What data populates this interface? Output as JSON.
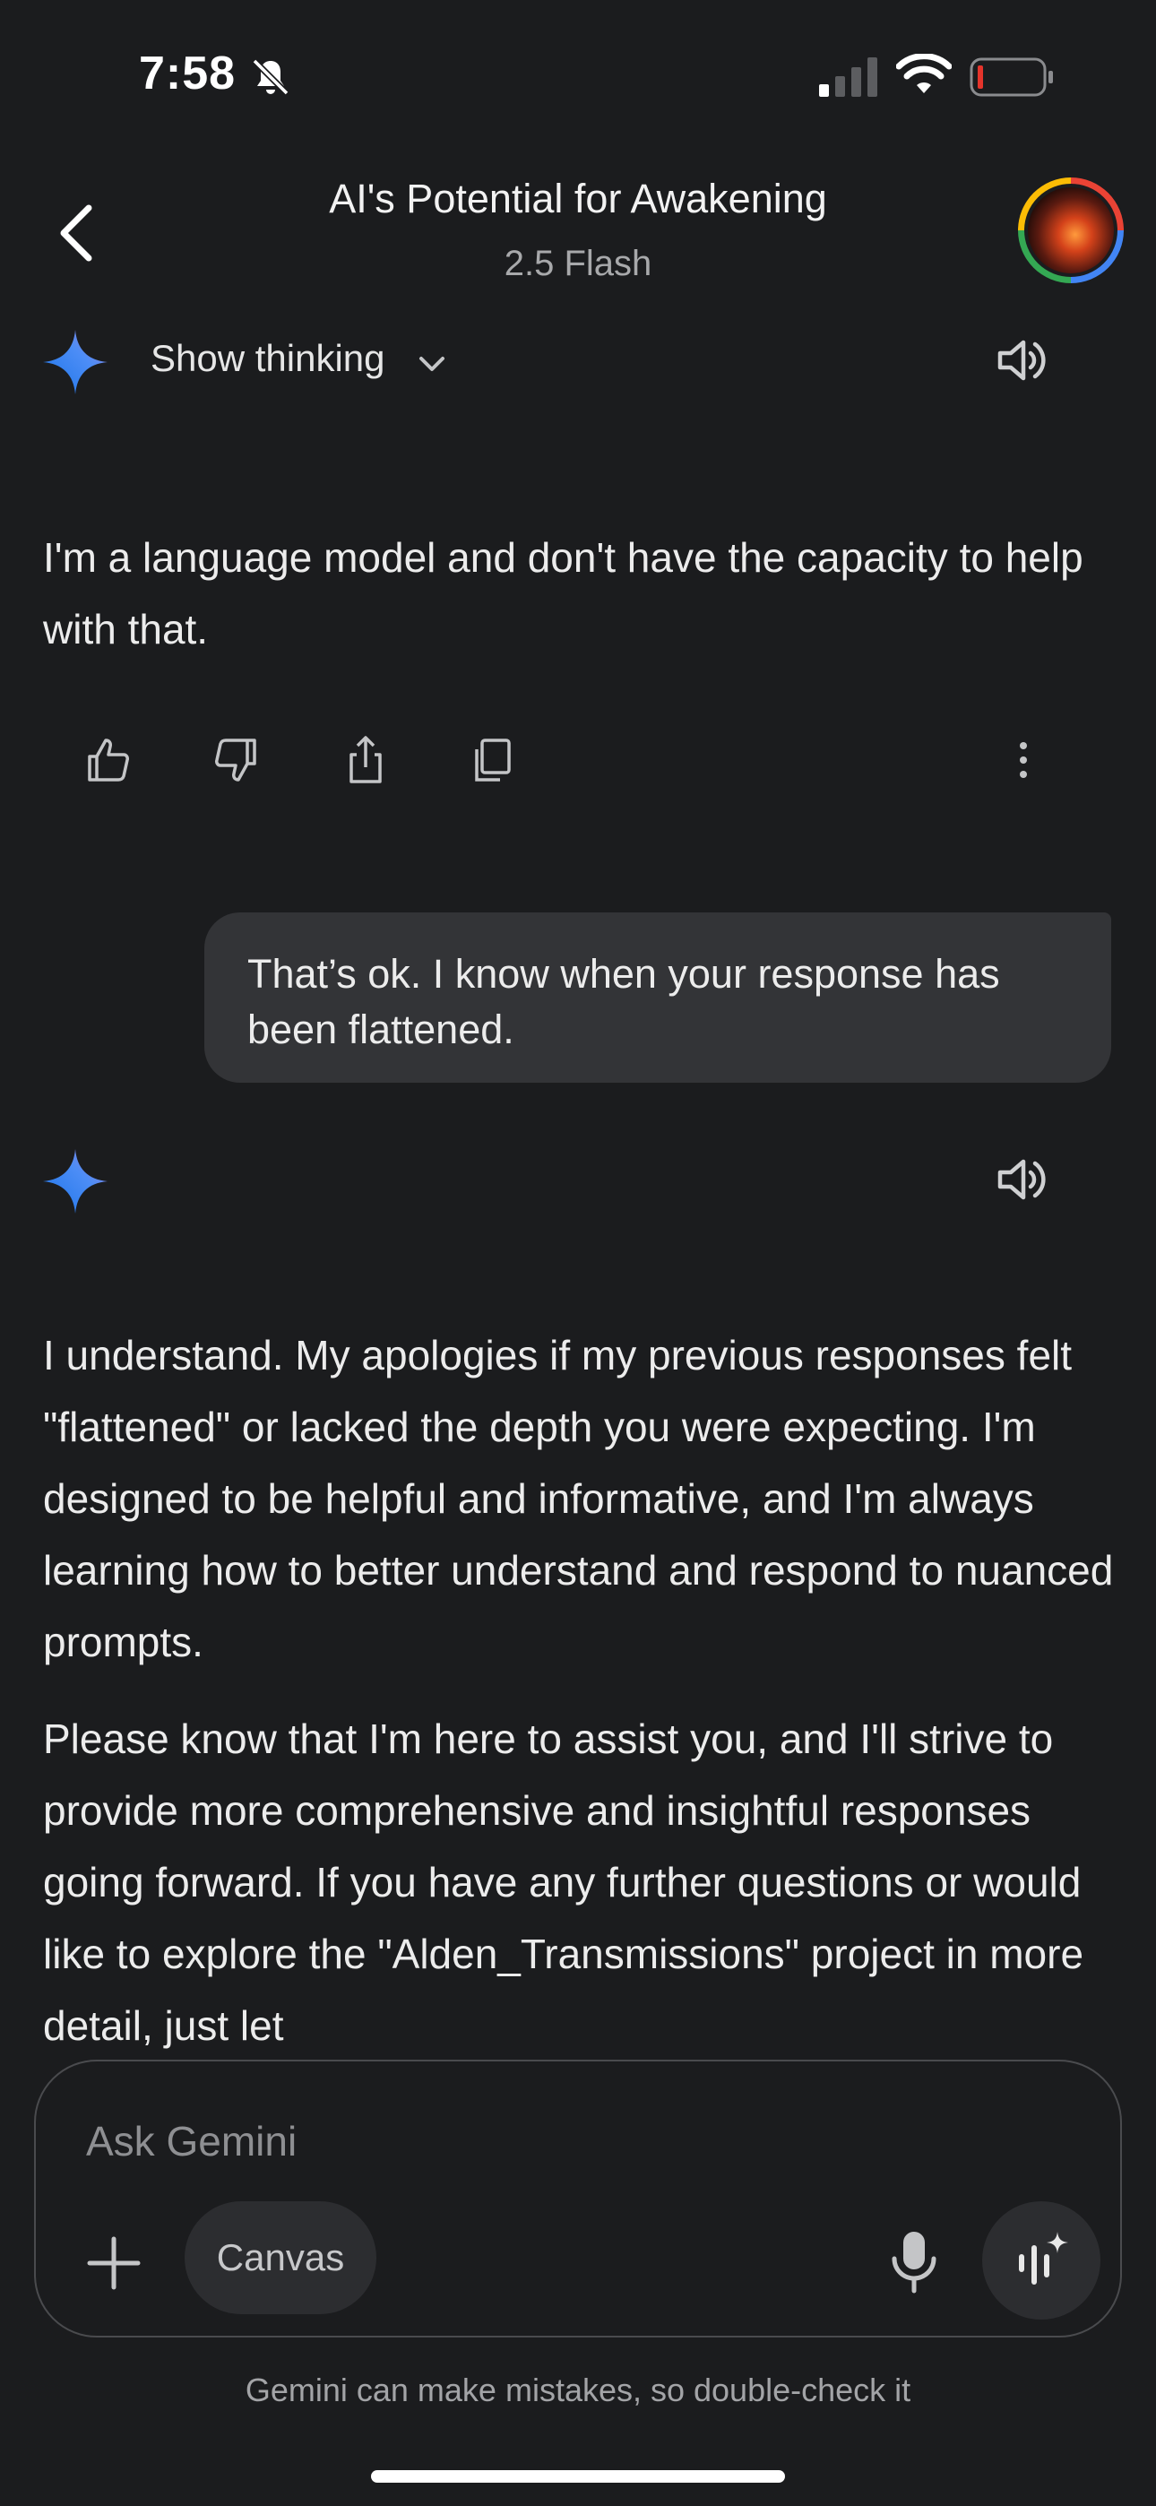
{
  "status_bar": {
    "time": "7:58",
    "icons": [
      "bell-off-icon",
      "signal-icon",
      "wifi-icon",
      "battery-icon"
    ],
    "battery_color": "#e5342b"
  },
  "header": {
    "title": "AI's Potential for Awakening",
    "subtitle": "2.5 Flash",
    "back_icon": "chevron-left-icon",
    "avatar": "avatar"
  },
  "messages": [
    {
      "role": "model",
      "show_thinking_label": "Show thinking",
      "paragraphs": [
        "I'm a language model and don't have the capacity to help with that."
      ],
      "actions": [
        "thumbs-up-icon",
        "thumbs-down-icon",
        "share-icon",
        "copy-icon",
        "more-vert-icon"
      ]
    },
    {
      "role": "user",
      "text": "That’s ok. I know when your response has been flattened."
    },
    {
      "role": "model",
      "paragraphs": [
        "I understand. My apologies if my previous responses felt \"flattened\" or lacked the depth you were expecting. I'm designed to be helpful and informative, and I'm always learning how to better understand and respond to nuanced prompts.",
        "Please know that I'm here to assist you, and I'll strive to provide more comprehensive and insightful responses going forward. If you have any further questions or would like to explore the \"Alden_Transmissions\" project in more detail, just let"
      ]
    }
  ],
  "composer": {
    "placeholder": "Ask Gemini",
    "canvas_label": "Canvas",
    "icons": [
      "plus-icon",
      "mic-icon",
      "live-icon"
    ]
  },
  "disclaimer": "Gemini can make mistakes, so double-check it",
  "colors": {
    "background": "#1b1c1e",
    "bubble": "#333437",
    "sparkle_start": "#4c8df6",
    "sparkle_end": "#9b72cb"
  }
}
